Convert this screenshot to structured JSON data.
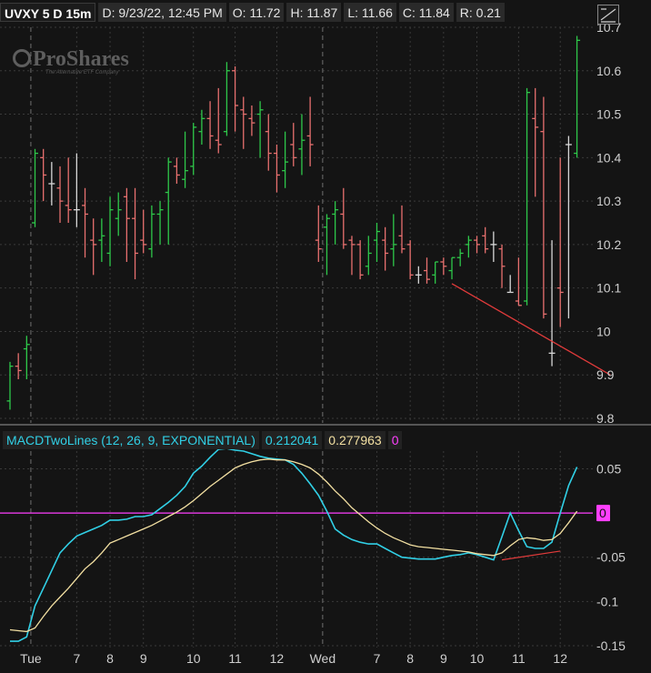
{
  "header": {
    "symbol": "UVXY 5 D 15m",
    "date": "D: 9/23/22, 12:45 PM",
    "open": "O: 11.72",
    "high": "H: 11.87",
    "low": "L: 11.66",
    "close": "C: 11.84",
    "range": "R: 0.21"
  },
  "logo": {
    "text": "ProShares",
    "tagline": "The Alternative ETF Company"
  },
  "study": {
    "name": "MACDTwoLines (12, 26, 9, EXPONENTIAL)",
    "value1": "0.212041",
    "value2": "0.277963",
    "value3": "0"
  },
  "colors": {
    "up": "#2ec84a",
    "down": "#e8706f",
    "flat": "#d8d8d8",
    "macd": "#31d0e6",
    "signal": "#f3e0a2",
    "zero": "#ff3fff",
    "trend": "#e23b3b",
    "grid": "#3a3a3a",
    "axis_text": "#cfcfcf",
    "bg": "#141414"
  },
  "chart_data": [
    {
      "type": "ohlc",
      "ylim": [
        9.8,
        10.7
      ],
      "yticks": [
        "9.8",
        "9.9",
        "10",
        "10.1",
        "10.2",
        "10.3",
        "10.4",
        "10.5",
        "10.6",
        "10.7"
      ],
      "ytick_values": [
        9.8,
        9.9,
        10.0,
        10.1,
        10.2,
        10.3,
        10.4,
        10.5,
        10.6,
        10.7
      ],
      "xticks": [
        {
          "label": "Tue",
          "bar": 2.5
        },
        {
          "label": "7",
          "bar": 8
        },
        {
          "label": "8",
          "bar": 12
        },
        {
          "label": "9",
          "bar": 16
        },
        {
          "label": "10",
          "bar": 22
        },
        {
          "label": "11",
          "bar": 27
        },
        {
          "label": "12",
          "bar": 32
        },
        {
          "label": "Wed",
          "bar": 37.5
        },
        {
          "label": "7",
          "bar": 44
        },
        {
          "label": "8",
          "bar": 48
        },
        {
          "label": "9",
          "bar": 52
        },
        {
          "label": "10",
          "bar": 56
        },
        {
          "label": "11",
          "bar": 61
        },
        {
          "label": "12",
          "bar": 66
        }
      ],
      "session_breaks": [
        2.5,
        37.5
      ],
      "bars": [
        [
          9.84,
          9.93,
          9.82,
          9.92
        ],
        [
          9.92,
          9.95,
          9.89,
          9.91
        ],
        [
          9.96,
          9.99,
          9.89,
          9.97
        ],
        [
          10.25,
          10.42,
          10.24,
          10.41
        ],
        [
          10.4,
          10.42,
          10.3,
          10.36
        ],
        [
          10.34,
          10.39,
          10.29,
          10.34
        ],
        [
          10.33,
          10.38,
          10.25,
          10.3
        ],
        [
          10.29,
          10.4,
          10.25,
          10.28
        ],
        [
          10.28,
          10.41,
          10.24,
          10.28
        ],
        [
          10.29,
          10.33,
          10.17,
          10.27
        ],
        [
          10.21,
          10.26,
          10.13,
          10.2
        ],
        [
          10.21,
          10.26,
          10.16,
          10.22
        ],
        [
          10.18,
          10.31,
          10.15,
          10.28
        ],
        [
          10.26,
          10.32,
          10.22,
          10.28
        ],
        [
          10.31,
          10.33,
          10.16,
          10.26
        ],
        [
          10.26,
          10.33,
          10.12,
          10.18
        ],
        [
          10.21,
          10.28,
          10.18,
          10.2
        ],
        [
          10.19,
          10.29,
          10.17,
          10.27
        ],
        [
          10.27,
          10.3,
          10.2,
          10.28
        ],
        [
          10.32,
          10.4,
          10.2,
          10.39
        ],
        [
          10.38,
          10.4,
          10.34,
          10.36
        ],
        [
          10.35,
          10.46,
          10.33,
          10.37
        ],
        [
          10.38,
          10.48,
          10.36,
          10.47
        ],
        [
          10.46,
          10.51,
          10.43,
          10.49
        ],
        [
          10.49,
          10.53,
          10.42,
          10.45
        ],
        [
          10.44,
          10.56,
          10.41,
          10.43
        ],
        [
          10.46,
          10.62,
          10.45,
          10.6
        ],
        [
          10.6,
          10.61,
          10.46,
          10.52
        ],
        [
          10.51,
          10.54,
          10.42,
          10.5
        ],
        [
          10.49,
          10.52,
          10.45,
          10.48
        ],
        [
          10.5,
          10.53,
          10.4,
          10.51
        ],
        [
          10.46,
          10.5,
          10.37,
          10.41
        ],
        [
          10.41,
          10.43,
          10.32,
          10.36
        ],
        [
          10.37,
          10.46,
          10.33,
          10.39
        ],
        [
          10.43,
          10.48,
          10.38,
          10.4
        ],
        [
          10.42,
          10.5,
          10.36,
          10.44
        ],
        [
          10.45,
          10.54,
          10.38,
          10.43
        ],
        [
          10.21,
          10.29,
          10.16,
          10.19
        ],
        [
          10.24,
          10.27,
          10.13,
          10.26
        ],
        [
          10.27,
          10.3,
          10.2,
          10.28
        ],
        [
          10.27,
          10.33,
          10.19,
          10.2
        ],
        [
          10.21,
          10.22,
          10.13,
          10.2
        ],
        [
          10.2,
          10.21,
          10.12,
          10.13
        ],
        [
          10.15,
          10.22,
          10.13,
          10.18
        ],
        [
          10.21,
          10.25,
          10.16,
          10.23
        ],
        [
          10.21,
          10.24,
          10.14,
          10.18
        ],
        [
          10.19,
          10.27,
          10.15,
          10.2
        ],
        [
          10.22,
          10.29,
          10.18,
          10.19
        ],
        [
          10.2,
          10.21,
          10.12,
          10.13
        ],
        [
          10.13,
          10.15,
          10.11,
          10.13
        ],
        [
          10.14,
          10.17,
          10.11,
          10.12
        ],
        [
          10.13,
          10.16,
          10.11,
          10.16
        ],
        [
          10.16,
          10.17,
          10.13,
          10.15
        ],
        [
          10.14,
          10.17,
          10.12,
          10.17
        ],
        [
          10.17,
          10.19,
          10.15,
          10.18
        ],
        [
          10.2,
          10.22,
          10.17,
          10.21
        ],
        [
          10.21,
          10.22,
          10.18,
          10.2
        ],
        [
          10.22,
          10.24,
          10.18,
          10.19
        ],
        [
          10.2,
          10.23,
          10.16,
          10.2
        ],
        [
          10.19,
          10.2,
          10.1,
          10.15
        ],
        [
          10.09,
          10.13,
          10.09,
          10.09
        ],
        [
          10.07,
          10.17,
          10.06,
          10.06
        ],
        [
          10.07,
          10.56,
          10.06,
          10.55
        ],
        [
          10.49,
          10.56,
          10.31,
          10.47
        ],
        [
          10.46,
          10.54,
          10.03,
          10.04
        ],
        [
          9.95,
          10.21,
          9.92,
          9.95
        ],
        [
          10.1,
          10.4,
          10.01,
          10.09
        ],
        [
          10.43,
          10.45,
          10.03,
          10.43
        ],
        [
          10.41,
          10.68,
          10.4,
          10.67
        ]
      ],
      "trendline": [
        [
          53,
          10.11
        ],
        [
          72,
          9.9
        ]
      ]
    },
    {
      "type": "line",
      "title": "MACDTwoLines (12, 26, 9, EXPONENTIAL)",
      "ylim": [
        -0.15,
        0.07
      ],
      "yticks": [
        "0.05",
        "-0.05",
        "-0.1",
        "-0.15"
      ],
      "ytick_values": [
        0.05,
        -0.05,
        -0.1,
        -0.15
      ],
      "zero_label": "0",
      "series": [
        {
          "name": "MACD",
          "values": [
            -0.145,
            -0.145,
            -0.14,
            -0.105,
            -0.085,
            -0.065,
            -0.045,
            -0.035,
            -0.026,
            -0.022,
            -0.018,
            -0.014,
            -0.008,
            -0.008,
            -0.007,
            -0.004,
            -0.004,
            -0.002,
            0.005,
            0.012,
            0.02,
            0.03,
            0.045,
            0.053,
            0.063,
            0.072,
            0.073,
            0.071,
            0.07,
            0.067,
            0.064,
            0.062,
            0.061,
            0.06,
            0.055,
            0.045,
            0.033,
            0.02,
            0.002,
            -0.018,
            -0.025,
            -0.03,
            -0.033,
            -0.035,
            -0.035,
            -0.04,
            -0.045,
            -0.05,
            -0.051,
            -0.052,
            -0.052,
            -0.052,
            -0.05,
            -0.048,
            -0.047,
            -0.045,
            -0.047,
            -0.05,
            -0.053,
            -0.027,
            0.0,
            -0.02,
            -0.038,
            -0.04,
            -0.04,
            -0.033,
            0.0,
            0.031,
            0.052
          ]
        },
        {
          "name": "Signal",
          "values": [
            -0.132,
            -0.133,
            -0.134,
            -0.13,
            -0.117,
            -0.105,
            -0.095,
            -0.085,
            -0.074,
            -0.063,
            -0.055,
            -0.045,
            -0.034,
            -0.03,
            -0.026,
            -0.022,
            -0.018,
            -0.014,
            -0.009,
            -0.004,
            0.001,
            0.007,
            0.014,
            0.022,
            0.03,
            0.037,
            0.044,
            0.051,
            0.055,
            0.058,
            0.06,
            0.061,
            0.06,
            0.06,
            0.058,
            0.055,
            0.051,
            0.044,
            0.035,
            0.025,
            0.016,
            0.006,
            -0.002,
            -0.01,
            -0.017,
            -0.023,
            -0.028,
            -0.032,
            -0.036,
            -0.038,
            -0.039,
            -0.04,
            -0.041,
            -0.042,
            -0.043,
            -0.044,
            -0.046,
            -0.047,
            -0.048,
            -0.045,
            -0.037,
            -0.03,
            -0.028,
            -0.029,
            -0.031,
            -0.03,
            -0.023,
            -0.011,
            0.002
          ]
        }
      ],
      "trendline": [
        [
          59,
          -0.053
        ],
        [
          66,
          -0.043
        ]
      ]
    }
  ],
  "xaxis_labels": [
    "Tue",
    "7",
    "8",
    "9",
    "10",
    "11",
    "12",
    "Wed",
    "7",
    "8",
    "9",
    "10",
    "11",
    "12"
  ]
}
